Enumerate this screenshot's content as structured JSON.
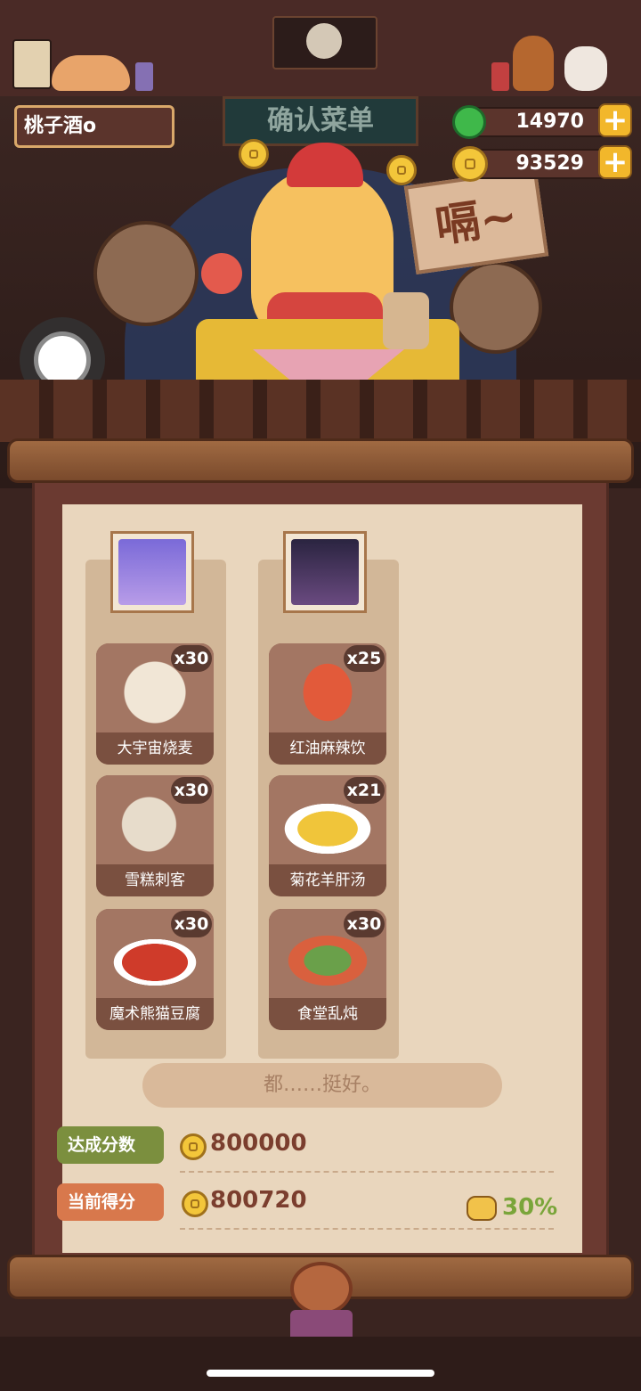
{
  "player": {
    "name": "桃子酒o"
  },
  "currency": {
    "jade": "14970",
    "coins": "93529",
    "plus": "+"
  },
  "banner": {
    "sign": "确认菜单",
    "speech": "嗝~"
  },
  "chefs": [
    {
      "dishes": [
        {
          "name": "大宇宙烧麦",
          "qty": "x30"
        },
        {
          "name": "雪糕刺客",
          "qty": "x30"
        },
        {
          "name": "魔术熊猫豆腐",
          "qty": "x30"
        }
      ]
    },
    {
      "dishes": [
        {
          "name": "红油麻辣饮",
          "qty": "x25"
        },
        {
          "name": "菊花羊肝汤",
          "qty": "x21"
        },
        {
          "name": "食堂乱炖",
          "qty": "x30"
        }
      ]
    }
  ],
  "comment": "都……挺好。",
  "results": {
    "target_label": "达成分数",
    "target_value": "800000",
    "current_label": "当前得分",
    "current_value": "800720",
    "bonus": "30%"
  },
  "colors": {
    "target_tag": "#7b8f3e",
    "current_tag": "#d8784c",
    "bonus_green": "#7aa53a"
  },
  "icons": [
    "jade-icon",
    "coin-icon",
    "plus-icon",
    "lantern-icon",
    "bonus-icon",
    "assistive-touch-icon"
  ]
}
